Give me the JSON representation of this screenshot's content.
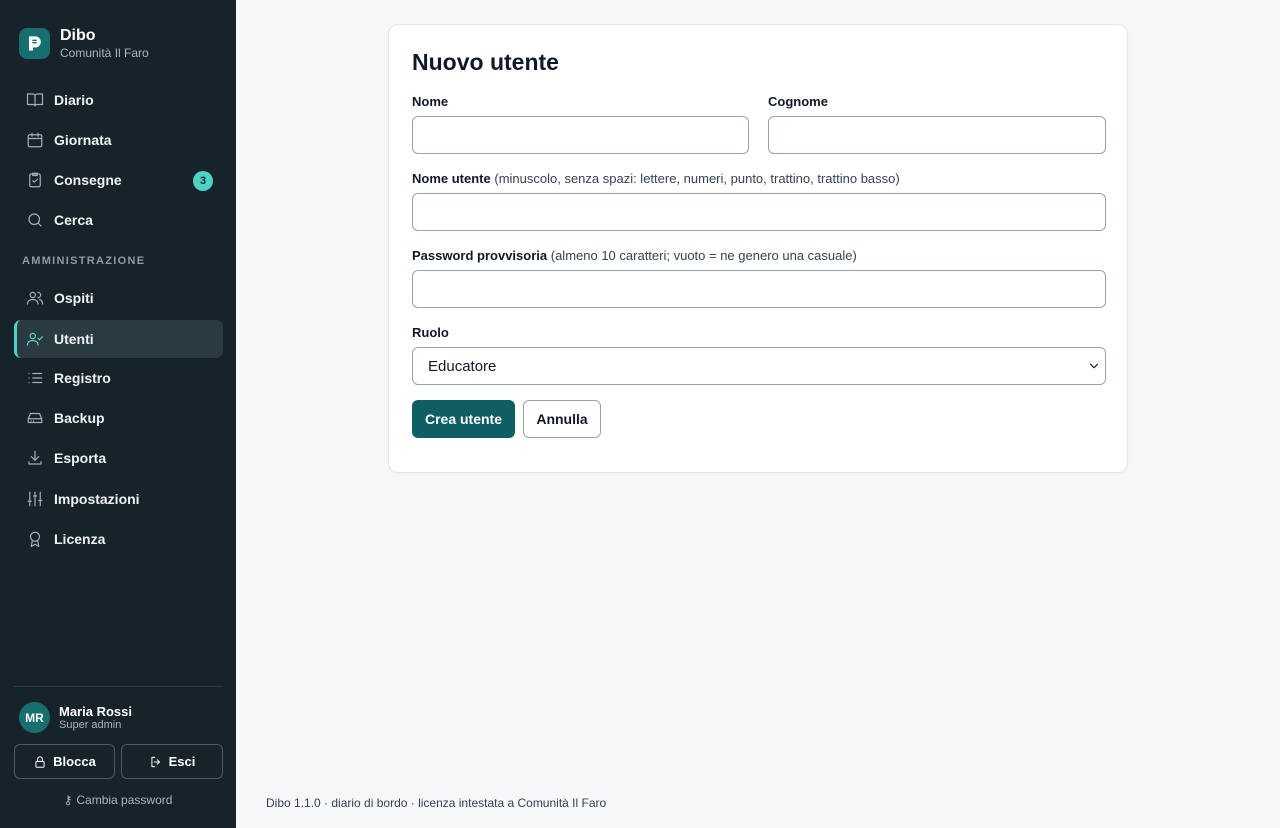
{
  "brand": {
    "name": "Dibo",
    "org": "Comunità Il Faro"
  },
  "sidebar": {
    "items": [
      {
        "label": "Diario",
        "icon": "book-icon"
      },
      {
        "label": "Giornata",
        "icon": "calendar-icon"
      },
      {
        "label": "Consegne",
        "icon": "clipboard-check-icon",
        "badge": "3"
      },
      {
        "label": "Cerca",
        "icon": "search-icon"
      }
    ],
    "section_label": "AMMINISTRAZIONE",
    "admin_items": [
      {
        "label": "Ospiti",
        "icon": "users-icon"
      },
      {
        "label": "Utenti",
        "icon": "user-check-icon",
        "active": true
      },
      {
        "label": "Registro",
        "icon": "list-icon"
      },
      {
        "label": "Backup",
        "icon": "hard-drive-icon"
      },
      {
        "label": "Esporta",
        "icon": "download-icon"
      },
      {
        "label": "Impostazioni",
        "icon": "sliders-icon"
      },
      {
        "label": "Licenza",
        "icon": "award-icon"
      }
    ],
    "user": {
      "initials": "MR",
      "name": "Maria Rossi",
      "role": "Super admin"
    },
    "lock_label": "Blocca",
    "logout_label": "Esci",
    "change_password_label": "Cambia password"
  },
  "form": {
    "title": "Nuovo utente",
    "first_name": {
      "label": "Nome",
      "value": ""
    },
    "last_name": {
      "label": "Cognome",
      "value": ""
    },
    "username": {
      "label": "Nome utente",
      "hint": "(minuscolo, senza spazi: lettere, numeri, punto, trattino, trattino basso)",
      "value": ""
    },
    "password": {
      "label": "Password provvisoria",
      "hint": "(almeno 10 caratteri; vuoto = ne genero una casuale)",
      "value": ""
    },
    "role": {
      "label": "Ruolo",
      "selected": "Educatore"
    },
    "submit_label": "Crea utente",
    "cancel_label": "Annulla"
  },
  "footer": {
    "text": "Dibo 1.1.0 · diario di bordo · licenza intestata a Comunità Il Faro"
  },
  "colors": {
    "sidebar_bg": "#16232a",
    "accent": "#4fd1c5",
    "primary": "#0f5e63"
  }
}
